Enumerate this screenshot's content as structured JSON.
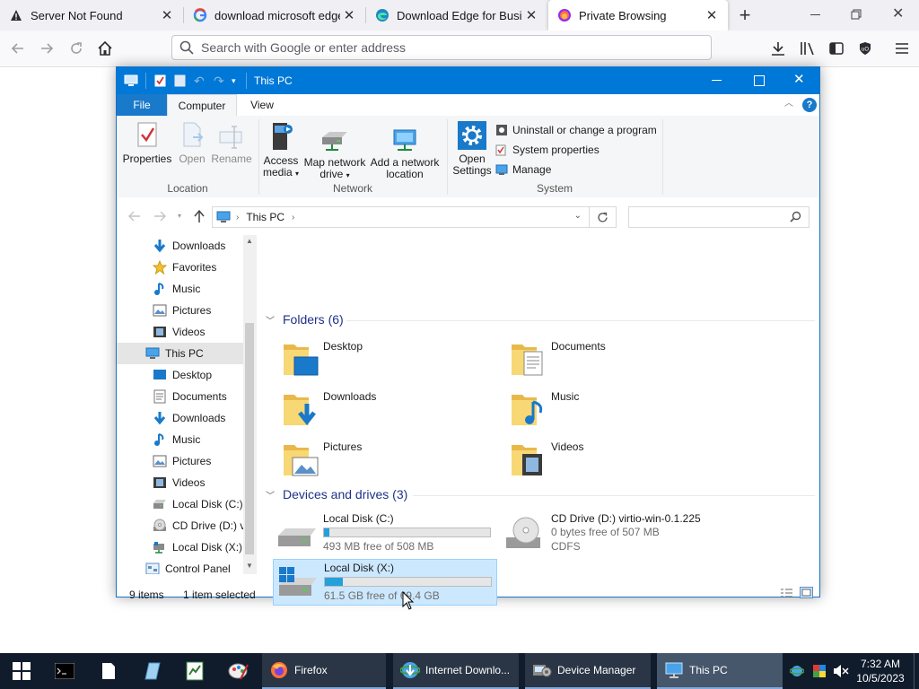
{
  "browser": {
    "tabs": [
      {
        "label": "Server Not Found",
        "icon": "warning-icon"
      },
      {
        "label": "download microsoft edge",
        "icon": "google-icon"
      },
      {
        "label": "Download Edge for Busine",
        "icon": "edge-icon"
      },
      {
        "label": "Private Browsing",
        "icon": "firefox-private-icon"
      }
    ],
    "url_placeholder": "Search with Google or enter address"
  },
  "explorer": {
    "title": "This PC",
    "ribbon_tabs": [
      "File",
      "Computer",
      "View"
    ],
    "ribbon": {
      "properties": "Properties",
      "open": "Open",
      "rename": "Rename",
      "location_group": "Location",
      "access_media_1": "Access",
      "access_media_2": "media",
      "map_drive_1": "Map network",
      "map_drive_2": "drive",
      "add_location_1": "Add a network",
      "add_location_2": "location",
      "network_group": "Network",
      "open_settings_1": "Open",
      "open_settings_2": "Settings",
      "uninstall": "Uninstall or change a program",
      "system_properties": "System properties",
      "manage": "Manage",
      "system_group": "System"
    },
    "breadcrumb": "This PC",
    "nav_items": [
      {
        "label": "Downloads",
        "icon": "downloads-icon"
      },
      {
        "label": "Favorites",
        "icon": "star-icon"
      },
      {
        "label": "Music",
        "icon": "music-icon"
      },
      {
        "label": "Pictures",
        "icon": "pictures-icon"
      },
      {
        "label": "Videos",
        "icon": "videos-icon"
      },
      {
        "label": "This PC",
        "icon": "computer-icon"
      },
      {
        "label": "Desktop",
        "icon": "desktop-icon"
      },
      {
        "label": "Documents",
        "icon": "documents-icon"
      },
      {
        "label": "Downloads",
        "icon": "downloads-icon"
      },
      {
        "label": "Music",
        "icon": "music-icon"
      },
      {
        "label": "Pictures",
        "icon": "pictures-icon"
      },
      {
        "label": "Videos",
        "icon": "videos-icon"
      },
      {
        "label": "Local Disk (C:)",
        "icon": "drive-icon"
      },
      {
        "label": "CD Drive (D:) v",
        "icon": "cd-drive-icon"
      },
      {
        "label": "Local Disk (X:)",
        "icon": "network-drive-icon"
      },
      {
        "label": "Control Panel",
        "icon": "control-panel-icon"
      }
    ],
    "folders_header": "Folders (6)",
    "folders": [
      {
        "label": "Desktop",
        "icon": "desktop-folder-icon"
      },
      {
        "label": "Documents",
        "icon": "documents-folder-icon"
      },
      {
        "label": "Downloads",
        "icon": "downloads-folder-icon"
      },
      {
        "label": "Music",
        "icon": "music-folder-icon"
      },
      {
        "label": "Pictures",
        "icon": "pictures-folder-icon"
      },
      {
        "label": "Videos",
        "icon": "videos-folder-icon"
      }
    ],
    "drives_header": "Devices and drives (3)",
    "drives": [
      {
        "name": "Local Disk (C:)",
        "free": "493 MB free of 508 MB",
        "used_fraction": 0.03
      },
      {
        "name": "CD Drive (D:) virtio-win-0.1.225",
        "free": "0 bytes free of 507 MB",
        "fs": "CDFS"
      },
      {
        "name": "Local Disk (X:)",
        "free": "61.5 GB free of 69.4 GB",
        "used_fraction": 0.11
      }
    ],
    "status_items": "9 items",
    "status_selected": "1 item selected"
  },
  "taskbar": {
    "apps": [
      {
        "label": "Firefox",
        "icon": "firefox-icon"
      },
      {
        "label": "Internet Downlo...",
        "icon": "idm-icon"
      },
      {
        "label": "Device Manager",
        "icon": "device-manager-icon"
      },
      {
        "label": "This PC",
        "icon": "this-pc-icon"
      }
    ],
    "time": "7:32 AM",
    "date": "10/5/2023"
  },
  "colors": {
    "titlebar": "#0078d7",
    "selection": "#cce8ff",
    "drive_bar": "#26a0da",
    "taskbar": "#101c2c"
  }
}
